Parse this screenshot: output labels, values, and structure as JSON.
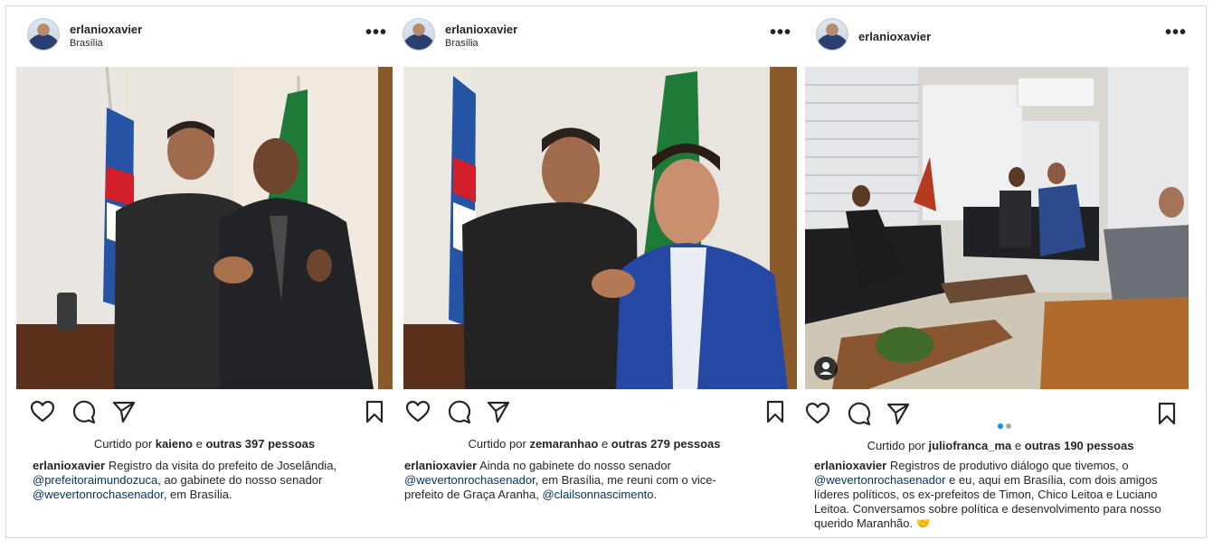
{
  "posts": [
    {
      "username": "erlanioxavier",
      "location": "Brasília",
      "more_label": "•••",
      "likes_prefix": "Curtido por",
      "likes_user": "kaieno",
      "likes_mid": "e",
      "likes_others": "outras 397 pessoas",
      "caption_user": "erlanioxavier",
      "caption_parts": [
        {
          "text": " Registro da visita do prefeito de Joselândia, ",
          "mention": false
        },
        {
          "text": "@prefeitoraimundozuca",
          "mention": true
        },
        {
          "text": ", ao gabinete do nosso senador ",
          "mention": false
        },
        {
          "text": "@wevertonrochasenador",
          "mention": true
        },
        {
          "text": ", em Brasília.",
          "mention": false
        }
      ],
      "icons": [
        "heart-icon",
        "comment-icon",
        "share-icon",
        "bookmark-icon"
      ]
    },
    {
      "username": "erlanioxavier",
      "location": "Brasília",
      "more_label": "•••",
      "likes_prefix": "Curtido por",
      "likes_user": "zemaranhao",
      "likes_mid": "e",
      "likes_others": "outras 279 pessoas",
      "caption_user": "erlanioxavier",
      "caption_parts": [
        {
          "text": " Ainda no gabinete do nosso senador ",
          "mention": false
        },
        {
          "text": "@wevertonrochasenador",
          "mention": true
        },
        {
          "text": ", em Brasília, me reuni com o vice-prefeito de Graça Aranha, ",
          "mention": false
        },
        {
          "text": "@clailsonnascimento",
          "mention": true
        },
        {
          "text": ".",
          "mention": false
        }
      ],
      "icons": [
        "heart-icon",
        "comment-icon",
        "share-icon",
        "bookmark-icon"
      ]
    },
    {
      "username": "erlanioxavier",
      "location": "",
      "more_label": "•••",
      "likes_prefix": "Curtido por",
      "likes_user": "juliofranca_ma",
      "likes_mid": "e",
      "likes_others": "outras 190 pessoas",
      "caption_user": "erlanioxavier",
      "caption_parts": [
        {
          "text": " Registros de produtivo diálogo que tivemos, o ",
          "mention": false
        },
        {
          "text": "@wevertonrochasenador",
          "mention": true
        },
        {
          "text": " e eu, aqui em Brasília, com dois amigos líderes políticos, os ex-prefeitos de Timon, Chico Leitoa e Luciano Leitoa. Conversamos sobre política e desenvolvimento para nosso querido Maranhão. 🤝",
          "mention": false
        }
      ],
      "carousel": {
        "count": 2,
        "active": 1
      },
      "icons": [
        "heart-icon",
        "comment-icon",
        "share-icon",
        "bookmark-icon",
        "user-tag-icon"
      ]
    }
  ],
  "colors": {
    "text": "#262626",
    "mention": "#00376b",
    "carousel_active": "#0095f6",
    "carousel_inactive": "#a8a8a8"
  }
}
